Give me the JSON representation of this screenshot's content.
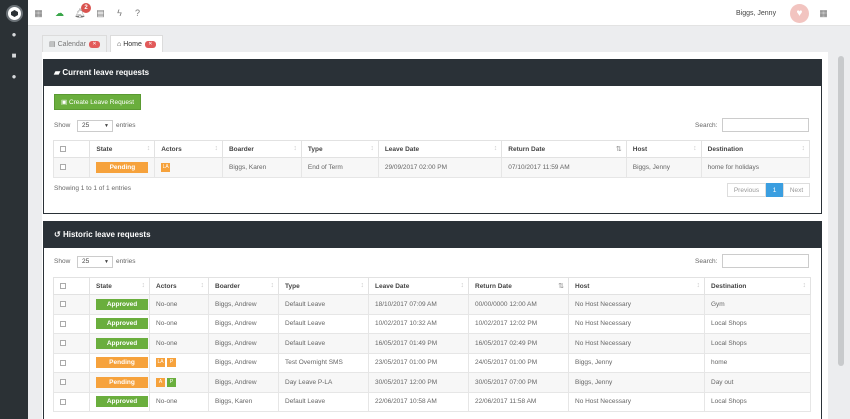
{
  "topbar": {
    "notification_count": "2",
    "user_name": "Biggs, Jenny"
  },
  "tabs": [
    {
      "label": "Calendar"
    },
    {
      "label": "Home"
    }
  ],
  "current": {
    "title": "Current leave requests",
    "create_button": "Create Leave Request",
    "show_label": "Show",
    "entries_value": "25",
    "entries_label": "entries",
    "search_label": "Search:",
    "columns": [
      "State",
      "Actors",
      "Boarder",
      "Type",
      "Leave Date",
      "Return Date",
      "Host",
      "Destination"
    ],
    "rows": [
      {
        "state": "Pending",
        "actors": [
          "LA"
        ],
        "boarder": "Biggs, Karen",
        "type": "End of Term",
        "leave": "29/09/2017 02:00 PM",
        "return": "07/10/2017 11:59 AM",
        "host": "Biggs, Jenny",
        "dest": "home for holidays"
      }
    ],
    "info": "Showing 1 to 1 of 1 entries",
    "prev": "Previous",
    "page": "1",
    "next": "Next"
  },
  "historic": {
    "title": "Historic leave requests",
    "show_label": "Show",
    "entries_value": "25",
    "entries_label": "entries",
    "search_label": "Search:",
    "columns": [
      "State",
      "Actors",
      "Boarder",
      "Type",
      "Leave Date",
      "Return Date",
      "Host",
      "Destination"
    ],
    "rows": [
      {
        "state": "Approved",
        "actors": "No-one",
        "boarder": "Biggs, Andrew",
        "type": "Default Leave",
        "leave": "18/10/2017 07:09 AM",
        "return": "00/00/0000 12:00 AM",
        "host": "No Host Necessary",
        "dest": "Gym"
      },
      {
        "state": "Approved",
        "actors": "No-one",
        "boarder": "Biggs, Andrew",
        "type": "Default Leave",
        "leave": "10/02/2017 10:32 AM",
        "return": "10/02/2017 12:02 PM",
        "host": "No Host Necessary",
        "dest": "Local Shops"
      },
      {
        "state": "Approved",
        "actors": "No-one",
        "boarder": "Biggs, Andrew",
        "type": "Default Leave",
        "leave": "16/05/2017 01:49 PM",
        "return": "16/05/2017 02:49 PM",
        "host": "No Host Necessary",
        "dest": "Local Shops"
      },
      {
        "state": "Pending",
        "actors": [
          "LA",
          "P"
        ],
        "boarder": "Biggs, Andrew",
        "type": "Test Overnight SMS",
        "leave": "23/05/2017 01:00 PM",
        "return": "24/05/2017 01:00 PM",
        "host": "Biggs, Jenny",
        "dest": "home"
      },
      {
        "state": "Pending",
        "actors": [
          "A",
          "P"
        ],
        "boarder": "Biggs, Andrew",
        "type": "Day Leave P-LA",
        "leave": "30/05/2017 12:00 PM",
        "return": "30/05/2017 07:00 PM",
        "host": "Biggs, Jenny",
        "dest": "Day out"
      },
      {
        "state": "Approved",
        "actors": "No-one",
        "boarder": "Biggs, Karen",
        "type": "Default Leave",
        "leave": "22/06/2017 10:58 AM",
        "return": "22/06/2017 11:58 AM",
        "host": "No Host Necessary",
        "dest": "Local Shops"
      }
    ]
  }
}
